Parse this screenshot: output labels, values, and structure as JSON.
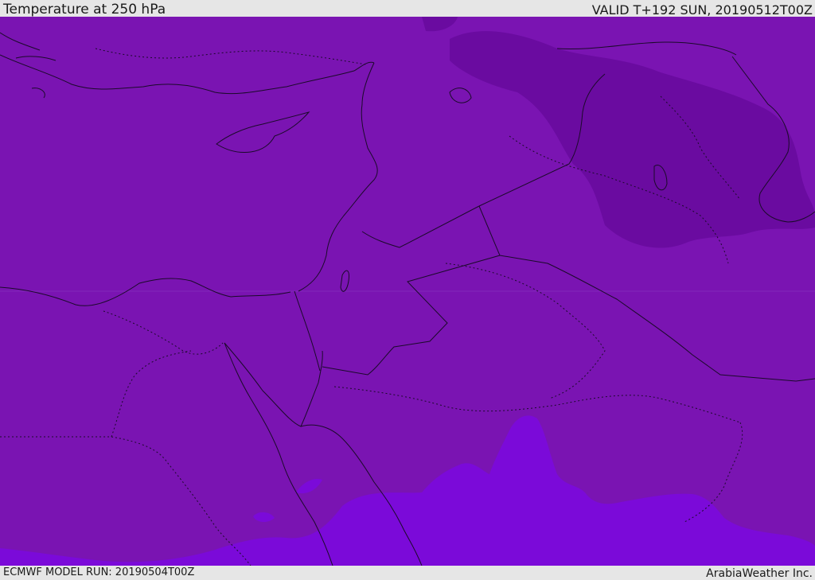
{
  "header": {
    "title": "Temperature at 250 hPa",
    "valid": "VALID T+192 SUN, 20190512T00Z"
  },
  "footer": {
    "model_run": "ECMWF MODEL RUN: 20190504T00Z",
    "credit": "ArabiaWeather Inc."
  },
  "map": {
    "colors": {
      "base": "#7a14b2",
      "cold": "#6a0ba0",
      "warm": "#7b0ad9",
      "border": "#1b0a2a",
      "gridline": "#8a3ac2"
    }
  }
}
